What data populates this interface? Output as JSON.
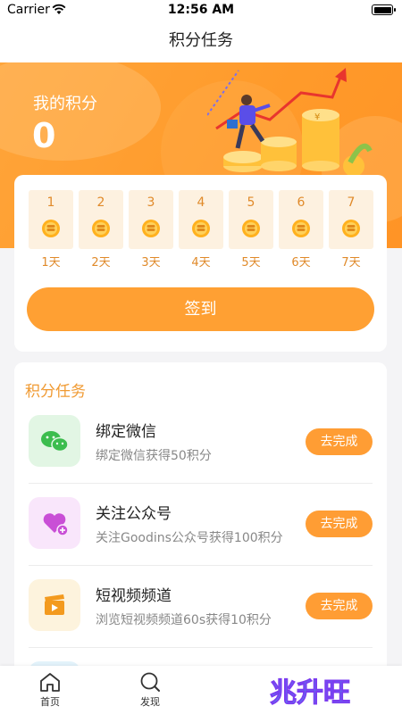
{
  "status_bar": {
    "carrier": "Carrier",
    "time": "12:56 AM"
  },
  "nav": {
    "title": "积分任务"
  },
  "hero": {
    "points_label": "我的积分",
    "points_value": "0"
  },
  "checkin": {
    "days": [
      {
        "number": "1",
        "label": "1天"
      },
      {
        "number": "2",
        "label": "2天"
      },
      {
        "number": "3",
        "label": "3天"
      },
      {
        "number": "4",
        "label": "4天"
      },
      {
        "number": "5",
        "label": "5天"
      },
      {
        "number": "6",
        "label": "6天"
      },
      {
        "number": "7",
        "label": "7天"
      }
    ],
    "button_label": "签到"
  },
  "tasks": {
    "title": "积分任务",
    "items": [
      {
        "name": "绑定微信",
        "desc": "绑定微信获得50积分",
        "button": "去完成",
        "icon": "wechat-icon"
      },
      {
        "name": "关注公众号",
        "desc": "关注Goodins公众号获得100积分",
        "button": "去完成",
        "icon": "heart-plus-icon"
      },
      {
        "name": "短视频频道",
        "desc": "浏览短视频频道60s获得10积分",
        "button": "去完成",
        "icon": "clapperboard-icon"
      }
    ]
  },
  "tab_bar": {
    "items": [
      {
        "label": "首页",
        "icon": "home-icon"
      },
      {
        "label": "发现",
        "icon": "discover-icon"
      }
    ],
    "brand_text": "兆升旺"
  },
  "colors": {
    "accent": "#ffa033",
    "hero": "#ff9a2a",
    "text_orange": "#e08a2a"
  }
}
